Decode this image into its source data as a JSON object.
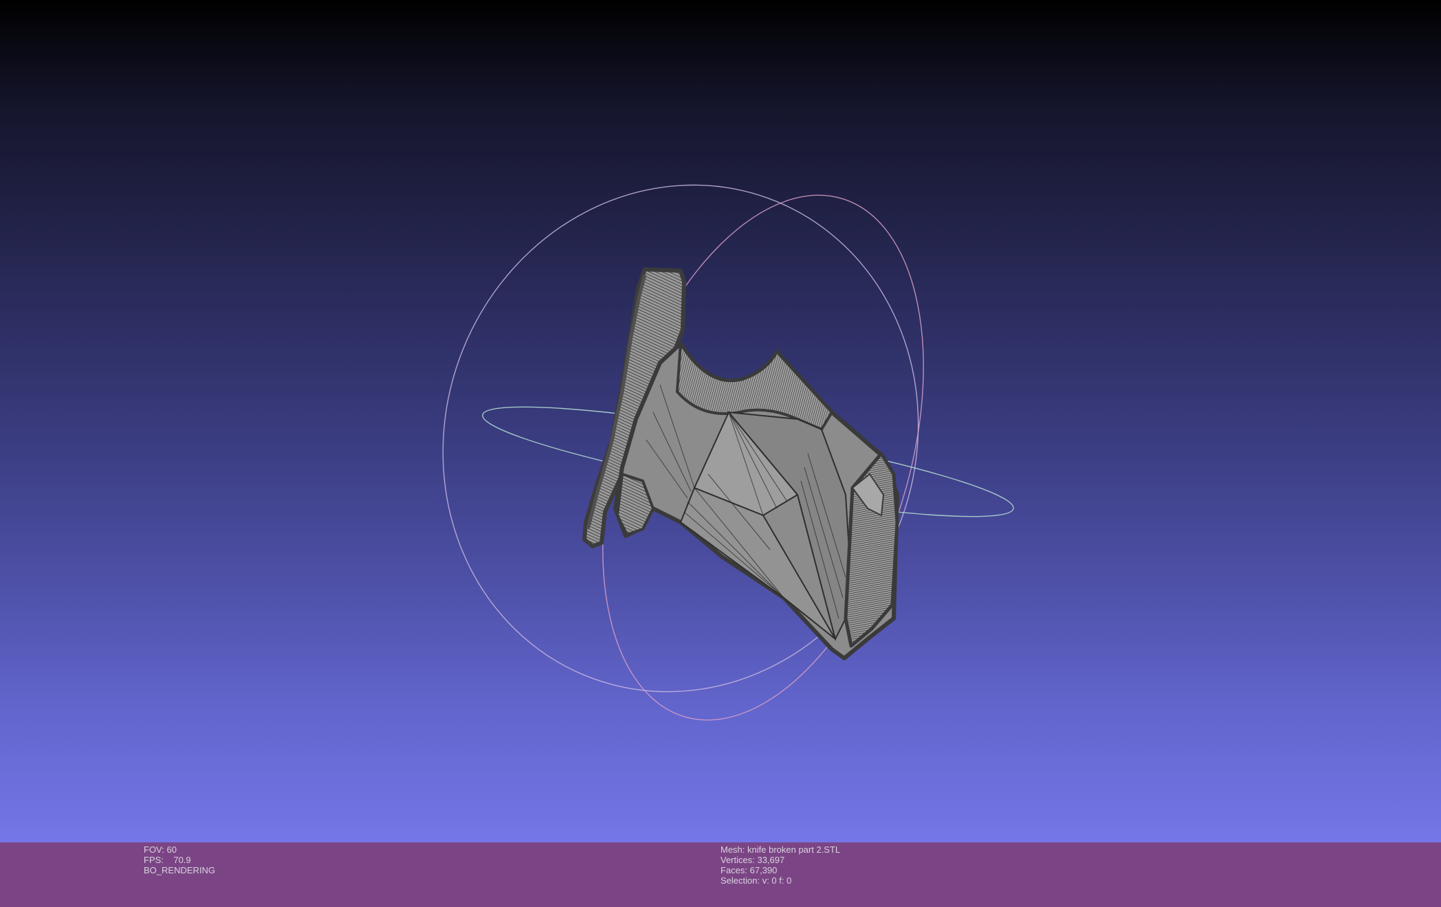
{
  "left_info": {
    "fov": "FOV: 60",
    "fps": "FPS:    70.9",
    "render_mode": "BO_RENDERING"
  },
  "mesh_info": {
    "mesh": "Mesh: knife broken part 2.STL",
    "vertices": "Vertices: 33,697",
    "faces": "Faces: 67,390",
    "selection": "Selection: v: 0 f: 0"
  },
  "colors": {
    "background_top": "#000000",
    "background_bottom": "#7576e8",
    "status_bar": "#7b4585",
    "status_text": "#d9d2de",
    "mesh_fill": "#8a8a8a",
    "mesh_edge": "#3a3a3a",
    "trackball_x": "#c8b8e0",
    "trackball_y": "#d8a0c8",
    "trackball_z": "#b0d8d0"
  },
  "icons": {
    "trackball": "trackball-gizmo-icon"
  }
}
